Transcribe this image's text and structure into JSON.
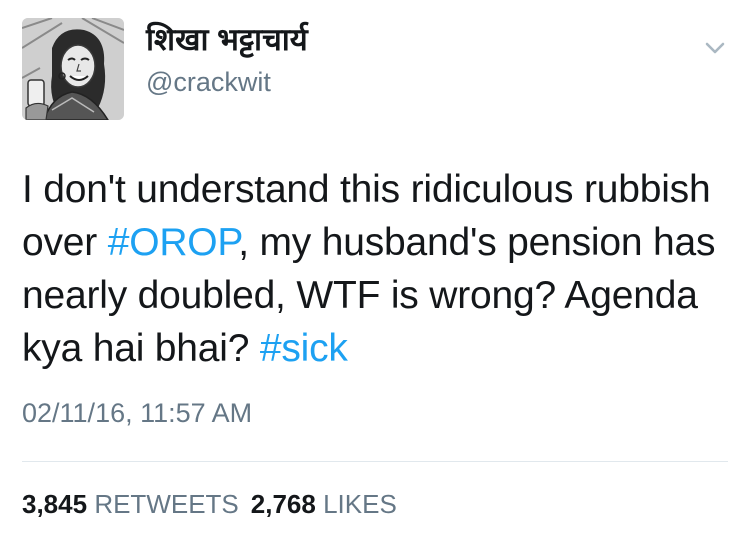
{
  "user": {
    "display_name": "शिखा भट्टाचार्य",
    "handle": "@crackwit",
    "avatar_icon": "avatar-sketch-portrait"
  },
  "tweet": {
    "text_segments": [
      {
        "text": "I don't understand this ridiculous rubbish over ",
        "type": "text"
      },
      {
        "text": "#OROP",
        "type": "hashtag"
      },
      {
        "text": ", my husband's pension has nearly doubled, WTF is wrong? Agenda kya hai bhai? ",
        "type": "text"
      },
      {
        "text": "#sick",
        "type": "hashtag"
      }
    ],
    "timestamp": "02/11/16, 11:57 AM"
  },
  "stats": {
    "retweets_count": "3,845",
    "retweets_label": "RETWEETS",
    "likes_count": "2,768",
    "likes_label": "LIKES"
  },
  "menu": {
    "icon": "chevron-down-icon"
  },
  "colors": {
    "hashtag": "#1da1f2",
    "secondary_text": "#657786",
    "primary_text": "#14171a",
    "divider": "#e1e8ed"
  }
}
